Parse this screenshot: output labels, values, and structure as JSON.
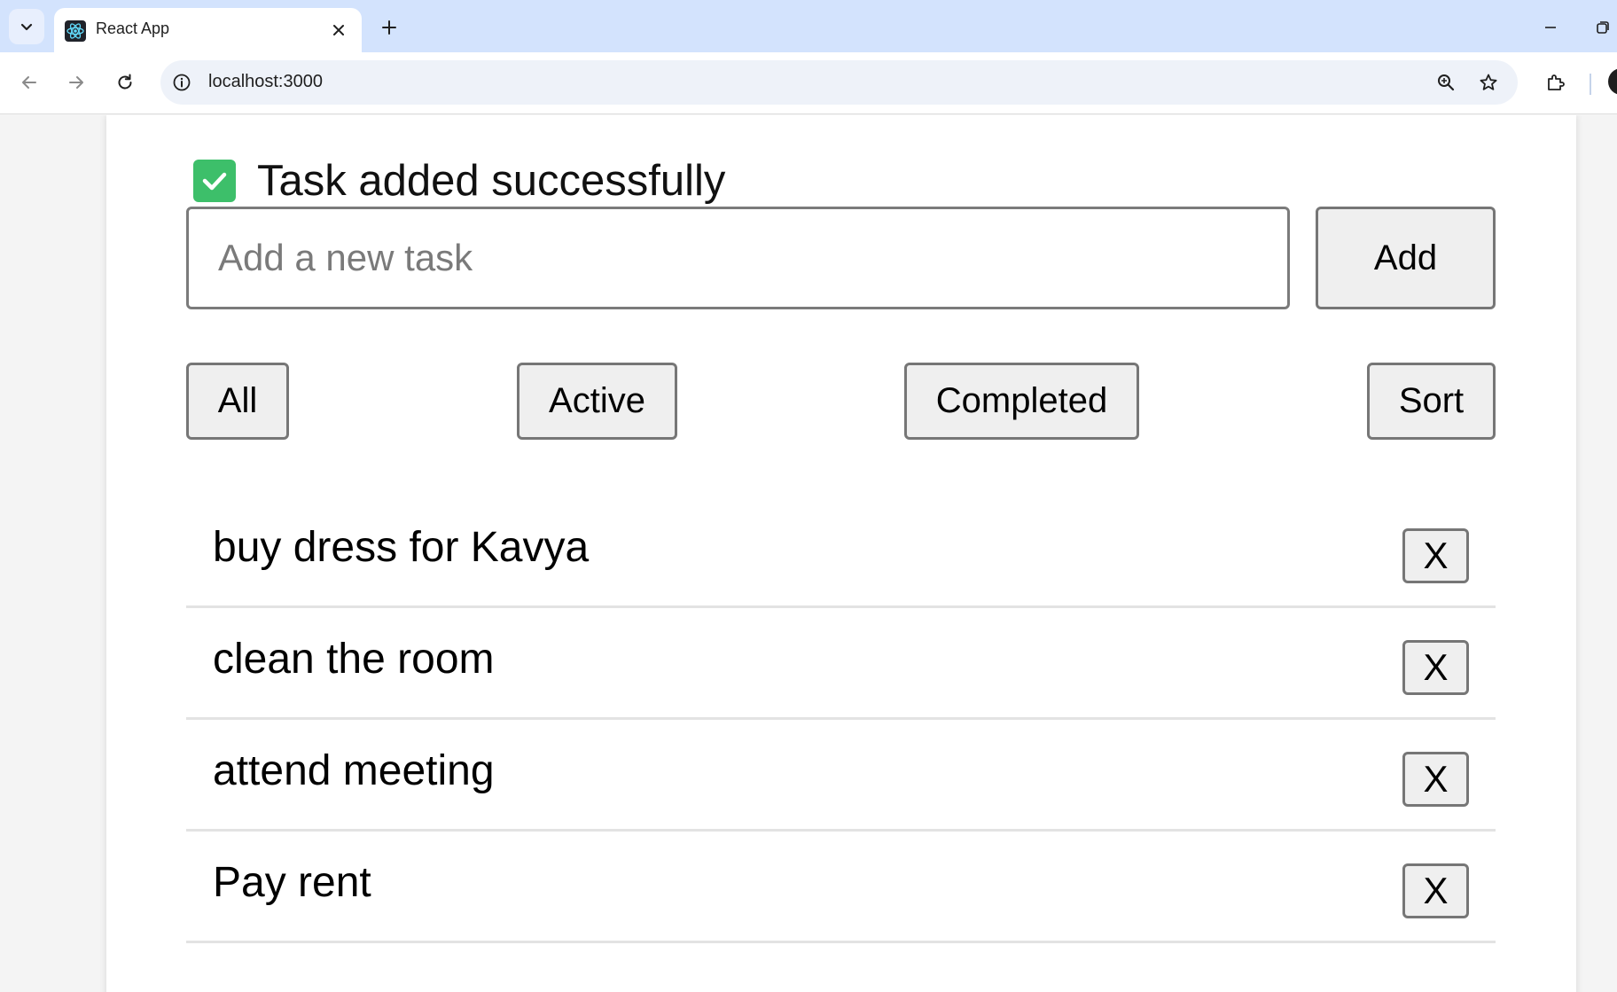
{
  "browser": {
    "tab_title": "React App",
    "url": "localhost:3000",
    "icons": {
      "tab_list": "chevron-down-icon",
      "favicon": "react-logo-icon",
      "close": "close-icon",
      "new_tab": "plus-icon",
      "back": "arrow-left-icon",
      "forward": "arrow-right-icon",
      "reload": "reload-icon",
      "site_info": "info-icon",
      "zoom": "zoom-in-icon",
      "bookmark": "star-icon",
      "extensions": "puzzle-icon"
    }
  },
  "app": {
    "toast": {
      "icon": "check-icon",
      "message": "Task added successfully",
      "color": "#3dbf6a"
    },
    "input": {
      "placeholder": "Add a new task",
      "value": ""
    },
    "add_label": "Add",
    "filters": {
      "all": "All",
      "active": "Active",
      "completed": "Completed",
      "sort": "Sort"
    },
    "tasks": [
      {
        "text": "buy dress for Kavya",
        "delete_label": "X"
      },
      {
        "text": "clean the room",
        "delete_label": "X"
      },
      {
        "text": "attend meeting",
        "delete_label": "X"
      },
      {
        "text": "Pay rent",
        "delete_label": "X"
      }
    ]
  }
}
